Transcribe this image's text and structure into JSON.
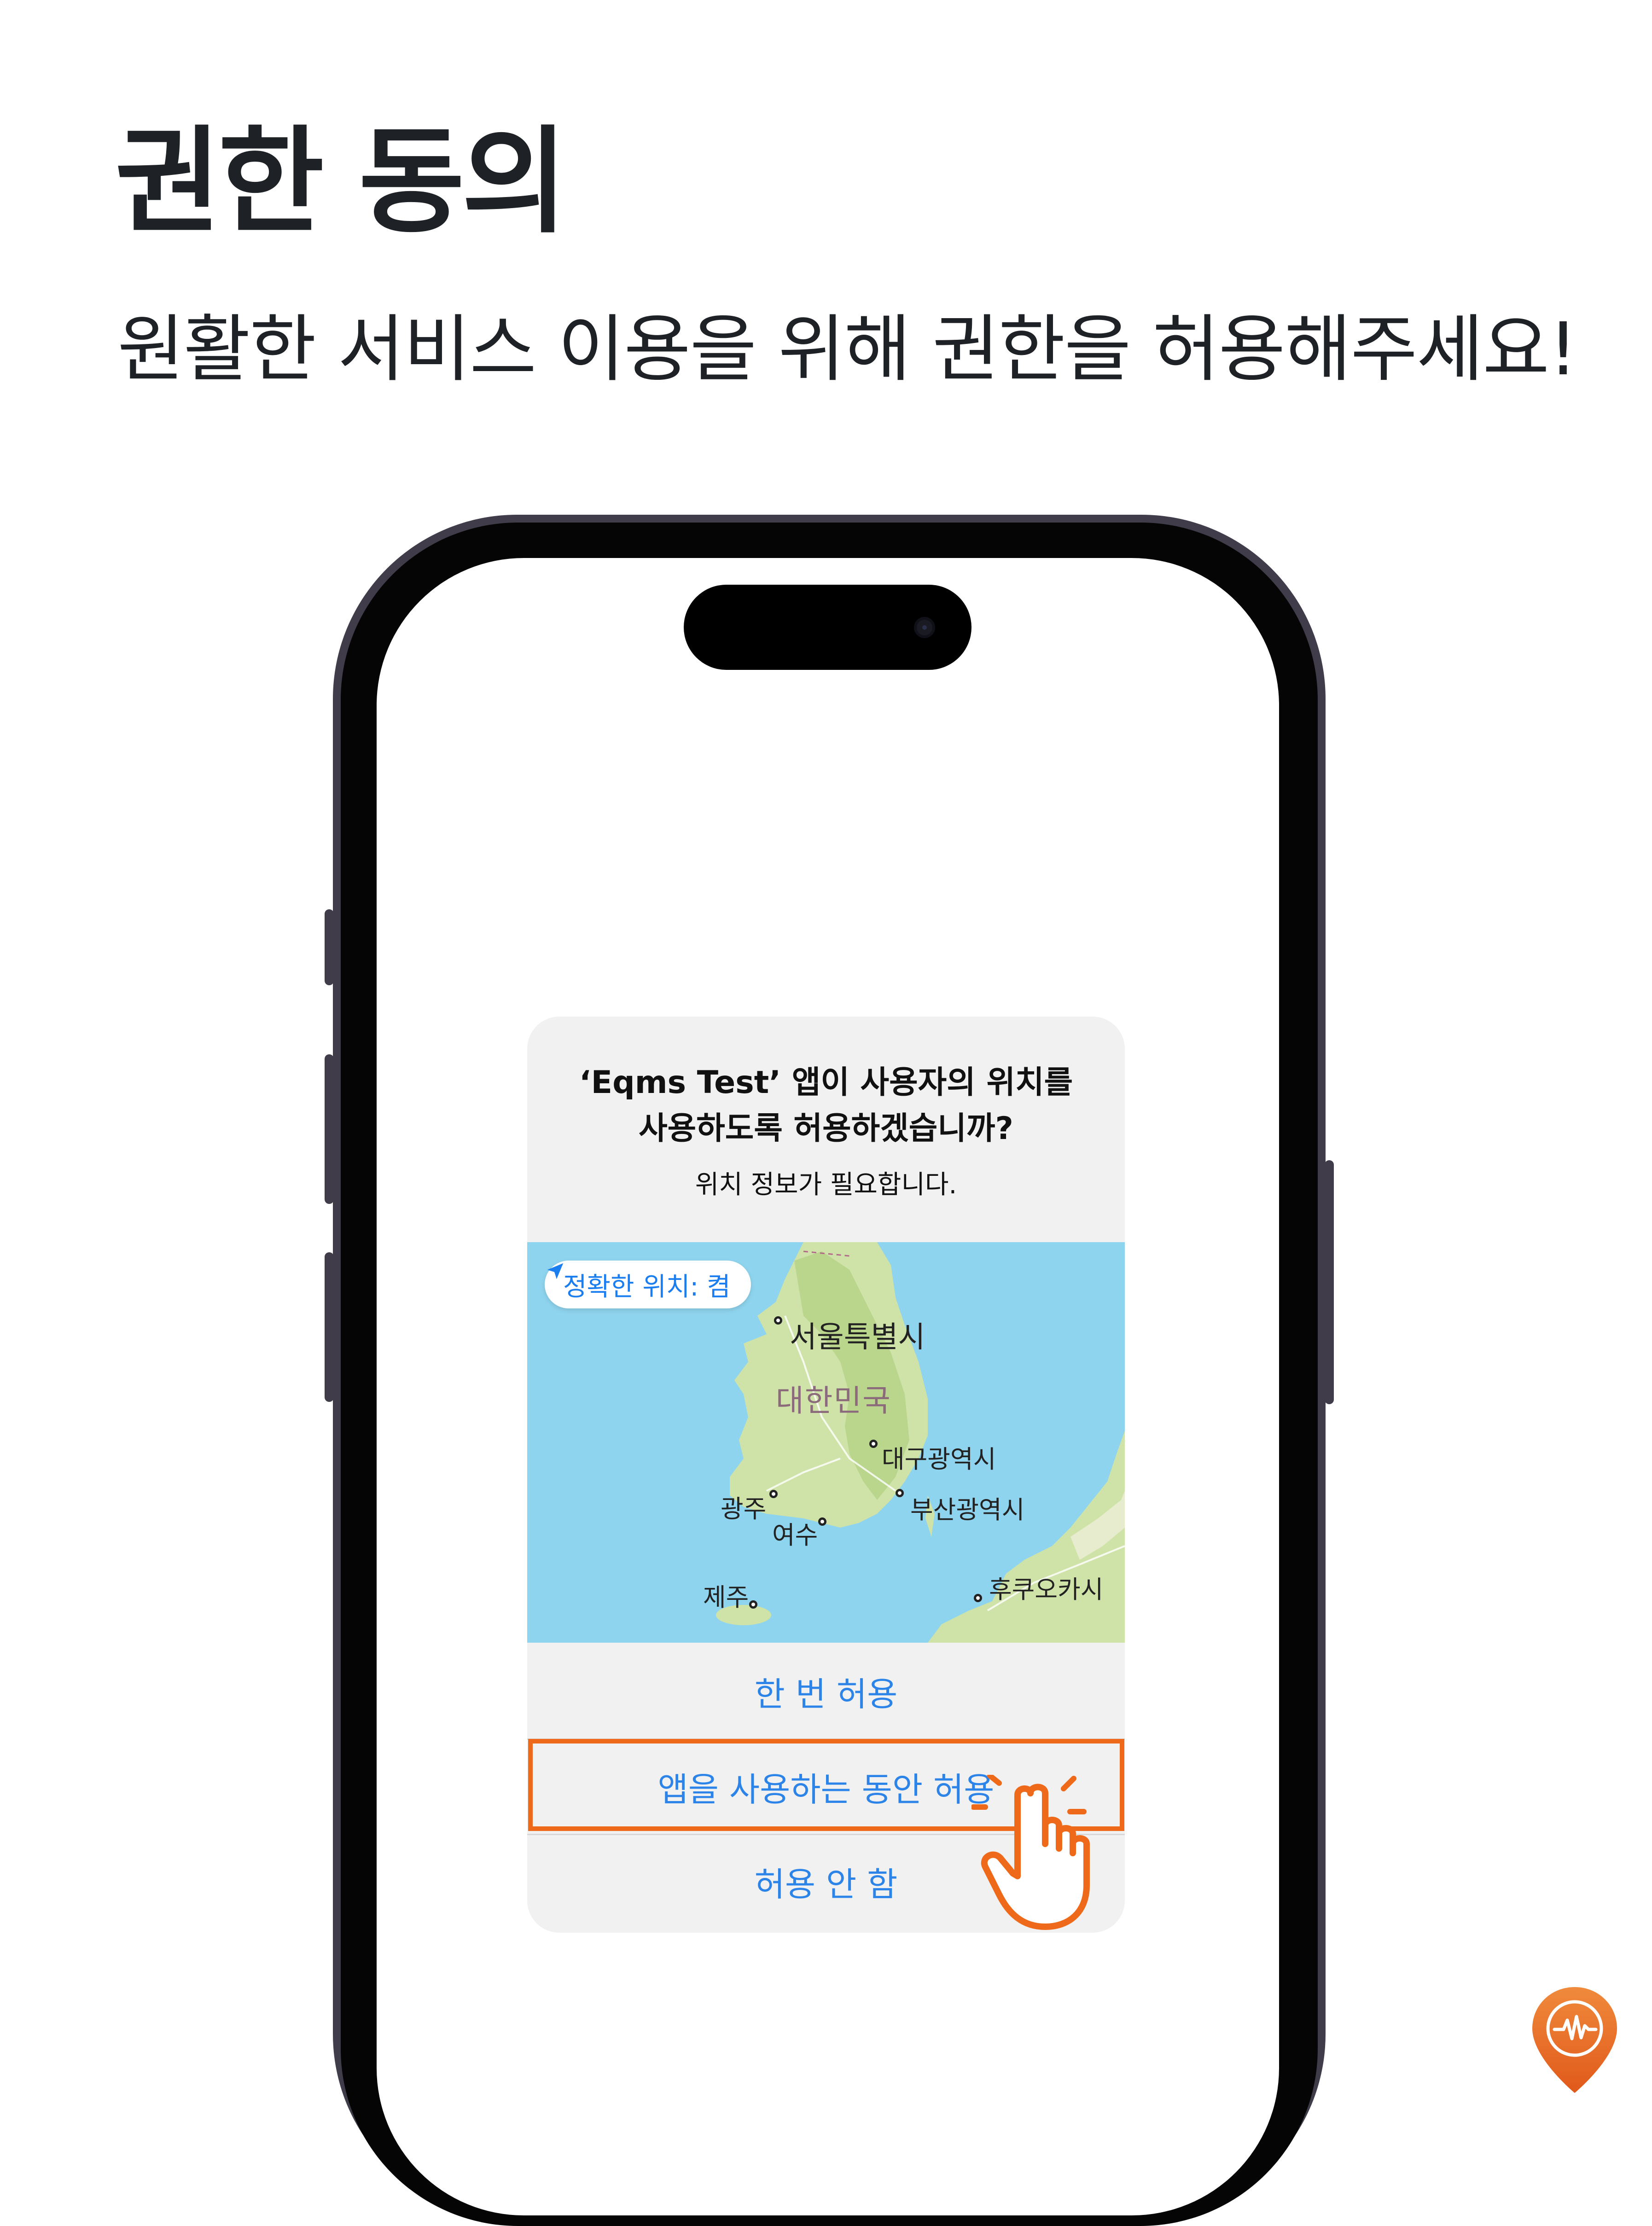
{
  "header": {
    "title": "권한 동의",
    "subtitle": "원활한 서비스 이용을 위해 권한을 허용해주세요!"
  },
  "alert": {
    "title_line1": "‘Eqms Test’ 앱이 사용자의 위치를",
    "title_line2": "사용하도록 허용하겠습니까?",
    "message": "위치 정보가 필요합니다.",
    "precise_location": "정확한 위치: 켬",
    "map": {
      "country": "대한민국",
      "cities": {
        "seoul": "서울특별시",
        "daegu": "대구광역시",
        "busan": "부산광역시",
        "gwangju": "광주",
        "yeosu": "여수",
        "jeju": "제주",
        "fukuoka": "후쿠오카시"
      }
    },
    "buttons": {
      "allow_once": "한 번 허용",
      "allow_while_using": "앱을 사용하는 동안 허용",
      "dont_allow": "허용 안 함"
    }
  },
  "colors": {
    "accent": "#ee6a1a",
    "ios_blue": "#2c84e8",
    "sea": "#8fd4ee",
    "land": "#cfe3a8"
  },
  "icons": {
    "location_arrow": "location-arrow-icon",
    "tap_hand": "tap-hand-icon",
    "brand_logo": "pin-logo-icon"
  }
}
